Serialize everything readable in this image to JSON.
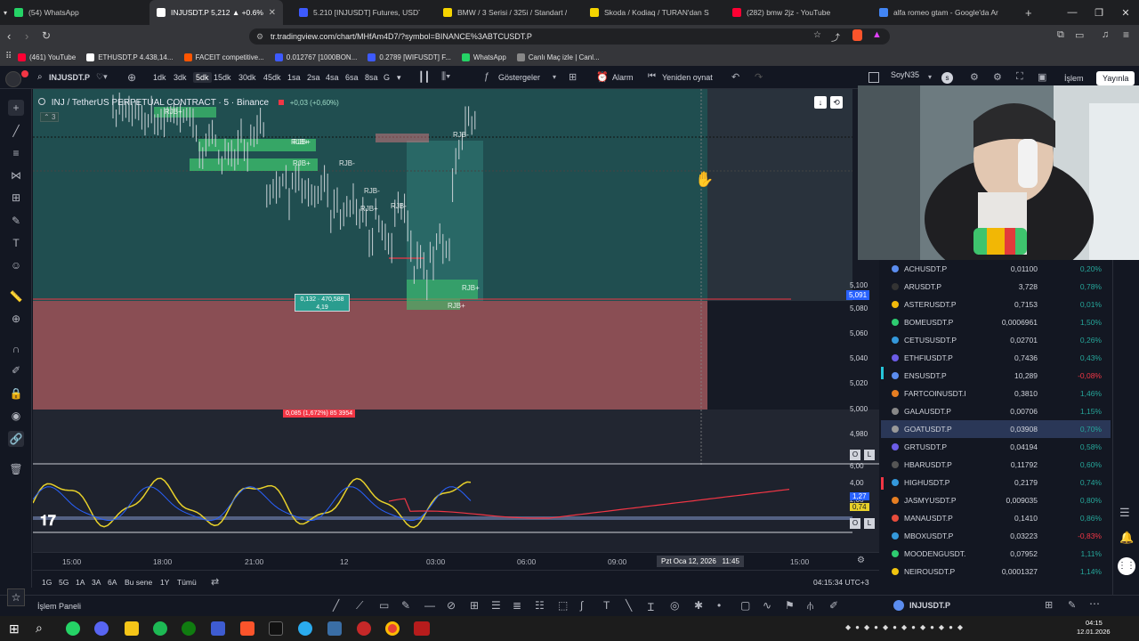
{
  "browser": {
    "tabs": [
      {
        "label": "(54) WhatsApp",
        "color": "#25d366"
      },
      {
        "label": "INJUSDT.P 5,212 ▲ +0.6% SoyN…",
        "color": "#ffffff",
        "active": true
      },
      {
        "label": "5.210 [INJUSDT] Futures, USDT-Marg…",
        "color": "#3d5afe"
      },
      {
        "label": "BMW / 3 Serisi / 325i / Standart / 06…",
        "color": "#f5d400"
      },
      {
        "label": "Skoda / Kodiaq / TURAN'dan SADEC…",
        "color": "#f5d400"
      },
      {
        "label": "(282) bmw 2jz - YouTube",
        "color": "#ff0033"
      },
      {
        "label": "alfa romeo gtam - Google'da Ara",
        "color": "#4285f4"
      }
    ],
    "url": "tr.tradingview.com/chart/MHfAm4D7/?symbol=BINANCE%3ABTCUSDT.P",
    "bookmarks": [
      {
        "label": "(461) YouTube",
        "color": "#ff0033"
      },
      {
        "label": "ETHUSDT.P 4.438,14...",
        "color": "#ffffff"
      },
      {
        "label": "FACEIT competitive...",
        "color": "#ff5500"
      },
      {
        "label": "0.012767 [1000BON...",
        "color": "#3d5afe"
      },
      {
        "label": "0.2789 [WIFUSDT] F...",
        "color": "#3d5afe"
      },
      {
        "label": "WhatsApp",
        "color": "#25d366"
      },
      {
        "label": "Canlı Maç izle | Canl...",
        "color": "#888888"
      }
    ]
  },
  "toolbar": {
    "symbol": "INJUSDT.P",
    "intervals": [
      "1dk",
      "3dk",
      "5dk",
      "15dk",
      "30dk",
      "45dk",
      "1sa",
      "2sa",
      "4sa",
      "6sa",
      "8sa",
      "G"
    ],
    "selected_interval": "5dk",
    "indicators_label": "Göstergeler",
    "alarm_label": "Alarm",
    "replay_label": "Yeniden oynat",
    "user_label": "SoyN35",
    "trade_label": "İşlem",
    "publish_label": "Yayınla"
  },
  "chart": {
    "legend_title": "INJ / TetherUS PERPETUAL CONTRACT · 5 · Binance",
    "legend_change": "+0,03 (+0,60%)",
    "legend_count": "3",
    "rjb_labels": [
      "RJB+",
      "RJB+",
      "RJB+",
      "RJB-",
      "RJB-",
      "RJB+",
      "RJB-",
      "RJB-",
      "RJB+",
      "RJB+",
      "RJB+"
    ],
    "position_box_label_1": "0,132 · 470,588",
    "position_box_label_2": "4,19",
    "stop_label": "0,085 (1,672%) 85 3954",
    "price_ticks": [
      "5,100",
      "5,080",
      "5,060",
      "5,040",
      "5,020",
      "5,000",
      "4,980"
    ],
    "current_price": "5,091",
    "osc_ticks": [
      "6,00",
      "4,00",
      "2,00"
    ],
    "osc_value_1": "1,27",
    "osc_value_2": "0,74",
    "time_labels": [
      "15:00",
      "18:00",
      "21:00",
      "12",
      "03:00",
      "06:00",
      "09:00",
      "15:00"
    ],
    "crosshair_time": "Pzt Oca 12, 2026   11:45",
    "scale_o": "O",
    "scale_l": "L"
  },
  "ranges": [
    "1G",
    "5G",
    "1A",
    "3A",
    "6A",
    "Bu sene",
    "1Y",
    "Tümü"
  ],
  "clock": "04:15:34 UTC+3",
  "bottom": {
    "panel_label": "İşlem Paneli",
    "watch_symbol": "INJUSDT.P"
  },
  "watchlist": [
    {
      "symbol": "ACHUSDT.P",
      "last": "0,01100",
      "change": "0,20%",
      "up": true,
      "color": "#5b8def"
    },
    {
      "symbol": "ARUSDT.P",
      "last": "3,728",
      "change": "0,78%",
      "up": true,
      "color": "#333333"
    },
    {
      "symbol": "ASTERUSDT.P",
      "last": "0,7153",
      "change": "0,01%",
      "up": true,
      "color": "#f0b90b"
    },
    {
      "symbol": "BOMEUSDT.P",
      "last": "0,0006961",
      "change": "1,50%",
      "up": true,
      "color": "#2ecc71"
    },
    {
      "symbol": "CETUSUSDT.P",
      "last": "0,02701",
      "change": "0,26%",
      "up": true,
      "color": "#3498db"
    },
    {
      "symbol": "ETHFIUSDT.P",
      "last": "0,7436",
      "change": "0,43%",
      "up": true,
      "color": "#6c5ce7"
    },
    {
      "symbol": "ENSUSDT.P",
      "last": "10,289",
      "change": "-0,08%",
      "up": false,
      "color": "#5b8def"
    },
    {
      "symbol": "FARTCOINUSDT.I",
      "last": "0,3810",
      "change": "1,46%",
      "up": true,
      "color": "#e67e22"
    },
    {
      "symbol": "GALAUSDT.P",
      "last": "0,00706",
      "change": "1,15%",
      "up": true,
      "color": "#888888"
    },
    {
      "symbol": "GOATUSDT.P",
      "last": "0,03908",
      "change": "0,70%",
      "up": true,
      "color": "#999999",
      "selected": true
    },
    {
      "symbol": "GRTUSDT.P",
      "last": "0,04194",
      "change": "0,58%",
      "up": true,
      "color": "#6c5ce7"
    },
    {
      "symbol": "HBARUSDT.P",
      "last": "0,11792",
      "change": "0,60%",
      "up": true,
      "color": "#555555"
    },
    {
      "symbol": "HIGHUSDT.P",
      "last": "0,2179",
      "change": "0,74%",
      "up": true,
      "color": "#3498db"
    },
    {
      "symbol": "JASMYUSDT.P",
      "last": "0,009035",
      "change": "0,80%",
      "up": true,
      "color": "#e67e22"
    },
    {
      "symbol": "MANAUSDT.P",
      "last": "0,1410",
      "change": "0,86%",
      "up": true,
      "color": "#e74c3c"
    },
    {
      "symbol": "MBOXUSDT.P",
      "last": "0,03223",
      "change": "-0,83%",
      "up": false,
      "color": "#3498db"
    },
    {
      "symbol": "MOODENGUSDT.",
      "last": "0,07952",
      "change": "1,11%",
      "up": true,
      "color": "#2ecc71"
    },
    {
      "symbol": "NEIROUSDT.P",
      "last": "0,0001327",
      "change": "1,14%",
      "up": true,
      "color": "#f1c40f"
    }
  ],
  "taskbar": {
    "time": "04:15",
    "date": "12.01.2026"
  },
  "colors": {
    "up": "#26a69a",
    "down": "#f23645",
    "accent": "#2962ff"
  }
}
